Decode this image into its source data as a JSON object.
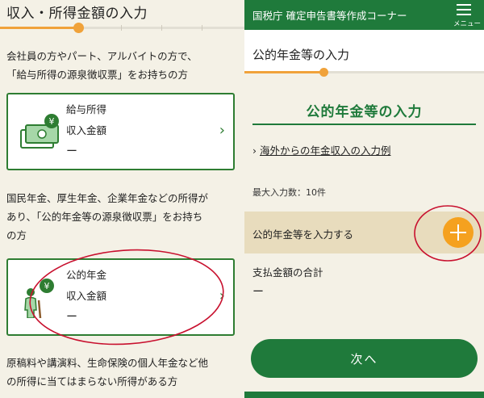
{
  "left": {
    "title": "収入・所得金額の入力",
    "progress": 0.32,
    "intro_line1": "会社員の方やパート、アルバイトの方で、",
    "intro_line2": "「給与所得の源泉徴収票」をお持ちの方",
    "salary_card": {
      "category": "給与所得",
      "label": "収入金額",
      "value": "ー",
      "currency": "¥"
    },
    "pension_intro_line1": "国民年金、厚生年金、企業年金などの所得が",
    "pension_intro_line2": "あり、「公的年金等の源泉徴収票」をお持ち",
    "pension_intro_line3": "の方",
    "pension_card": {
      "category": "公的年金",
      "label": "収入金額",
      "value": "ー",
      "currency": "¥"
    },
    "other_line1": "原稿料や講演料、生命保険の個人年金など他",
    "other_line2": "の所得に当てはまらない所得がある方",
    "chevron": "›"
  },
  "right": {
    "header_title": "国税庁 確定申告書等作成コーナー",
    "menu_label": "メニュー",
    "page_title": "公的年金等の入力",
    "progress": 0.33,
    "section_title": "公的年金等の入力",
    "link_prefix": "›",
    "link_text": "海外からの年金収入の入力例",
    "max_count": "最大入力数：10件",
    "entry_label": "公的年金等を入力する",
    "total_label": "支払金額の合計",
    "total_value": "ー",
    "next_label": "次へ"
  },
  "colors": {
    "brand_green": "#1f7a3b",
    "accent_orange": "#f5a11f",
    "annotation_red": "#c8102e",
    "panel_bg": "#f4f1e6"
  }
}
